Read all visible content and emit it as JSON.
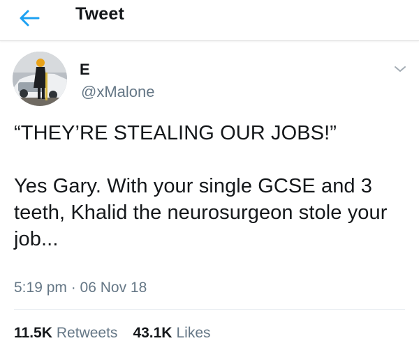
{
  "header": {
    "title": "Tweet",
    "back_icon": "arrow-left-icon",
    "accent_color": "#1da1f2"
  },
  "author": {
    "name": "E",
    "handle": "@xMalone",
    "avatar_icon": "profile-photo"
  },
  "tweet": {
    "text": "“THEY’RE STEALING OUR JOBS!”\n\nYes Gary. With your single GCSE and 3 teeth, Khalid the neurosurgeon stole your job...",
    "timestamp": "5:19 pm · 06 Nov 18"
  },
  "stats": {
    "retweets_count": "11.5K",
    "retweets_label": "Retweets",
    "likes_count": "43.1K",
    "likes_label": "Likes"
  },
  "colors": {
    "text": "#14171a",
    "secondary": "#657786",
    "divider": "#e1e8ed"
  }
}
